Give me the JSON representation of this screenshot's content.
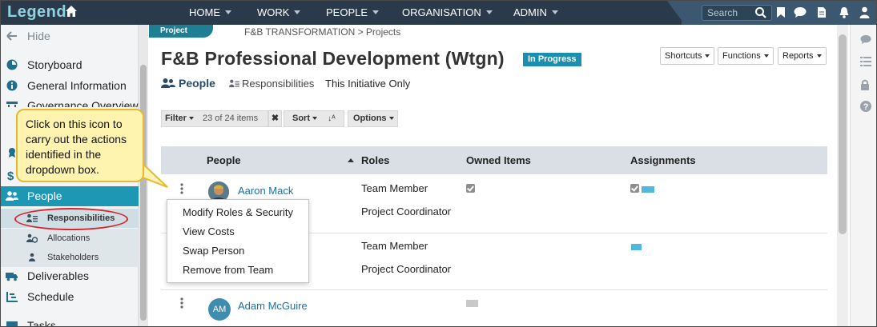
{
  "topbar": {
    "logo": "Legend",
    "nav": [
      {
        "label": "HOME"
      },
      {
        "label": "WORK"
      },
      {
        "label": "PEOPLE"
      },
      {
        "label": "ORGANISATION"
      },
      {
        "label": "ADMIN"
      }
    ],
    "search_placeholder": "Search",
    "icons": [
      "search-icon",
      "bookmark-icon",
      "chat-icon",
      "document-icon",
      "bell-icon",
      "user-icon"
    ]
  },
  "sidebar": {
    "hide_label": "Hide",
    "items": [
      {
        "label": "Storyboard",
        "icon": "storyboard-icon"
      },
      {
        "label": "General Information",
        "icon": "info-icon"
      },
      {
        "label": "Governance Overview",
        "icon": "governance-icon"
      },
      {
        "label": "People",
        "icon": "people-icon"
      },
      {
        "label": "Deliverables",
        "icon": "truck-icon"
      },
      {
        "label": "Schedule",
        "icon": "schedule-icon"
      },
      {
        "label": "Tasks",
        "icon": "tasks-icon"
      }
    ],
    "subitems": [
      {
        "label": "Responsibilities"
      },
      {
        "label": "Allocations"
      },
      {
        "label": "Stakeholders"
      }
    ]
  },
  "page": {
    "project_tab": "Project",
    "breadcrumb": "F&B TRANSFORMATION > Projects",
    "title": "F&B Professional Development (Wtgn)",
    "status": "In Progress",
    "buttons": {
      "shortcuts": "Shortcuts",
      "functions": "Functions",
      "reports": "Reports"
    },
    "subnav": {
      "people": "People",
      "responsibilities": "Responsibilities",
      "initiative": "This Initiative Only"
    },
    "toolbar": {
      "filter": "Filter",
      "count": "23 of 24 items",
      "sort": "Sort",
      "options": "Options"
    }
  },
  "table": {
    "headers": {
      "people": "People",
      "roles": "Roles",
      "owned": "Owned Items",
      "assignments": "Assignments"
    },
    "rows": [
      {
        "name": "Aaron Mack",
        "roles": [
          "Team Member",
          "Project Coordinator"
        ]
      },
      {
        "name": "",
        "roles": [
          "Team Member",
          "Project Coordinator"
        ]
      },
      {
        "name": "Adam McGuire",
        "initials": "AM",
        "roles": []
      }
    ]
  },
  "dropdown": {
    "items": [
      "Modify Roles & Security",
      "View Costs",
      "Swap Person",
      "Remove from Team"
    ]
  },
  "callout": {
    "text": "Click on this icon to carry out the actions identified in the dropdown box."
  },
  "colors": {
    "accent": "#1e97b4",
    "topbar": "#2b3a4a",
    "status": "#1a8fb0",
    "callout_border": "#e8b830",
    "highlight": "#d8232a"
  }
}
